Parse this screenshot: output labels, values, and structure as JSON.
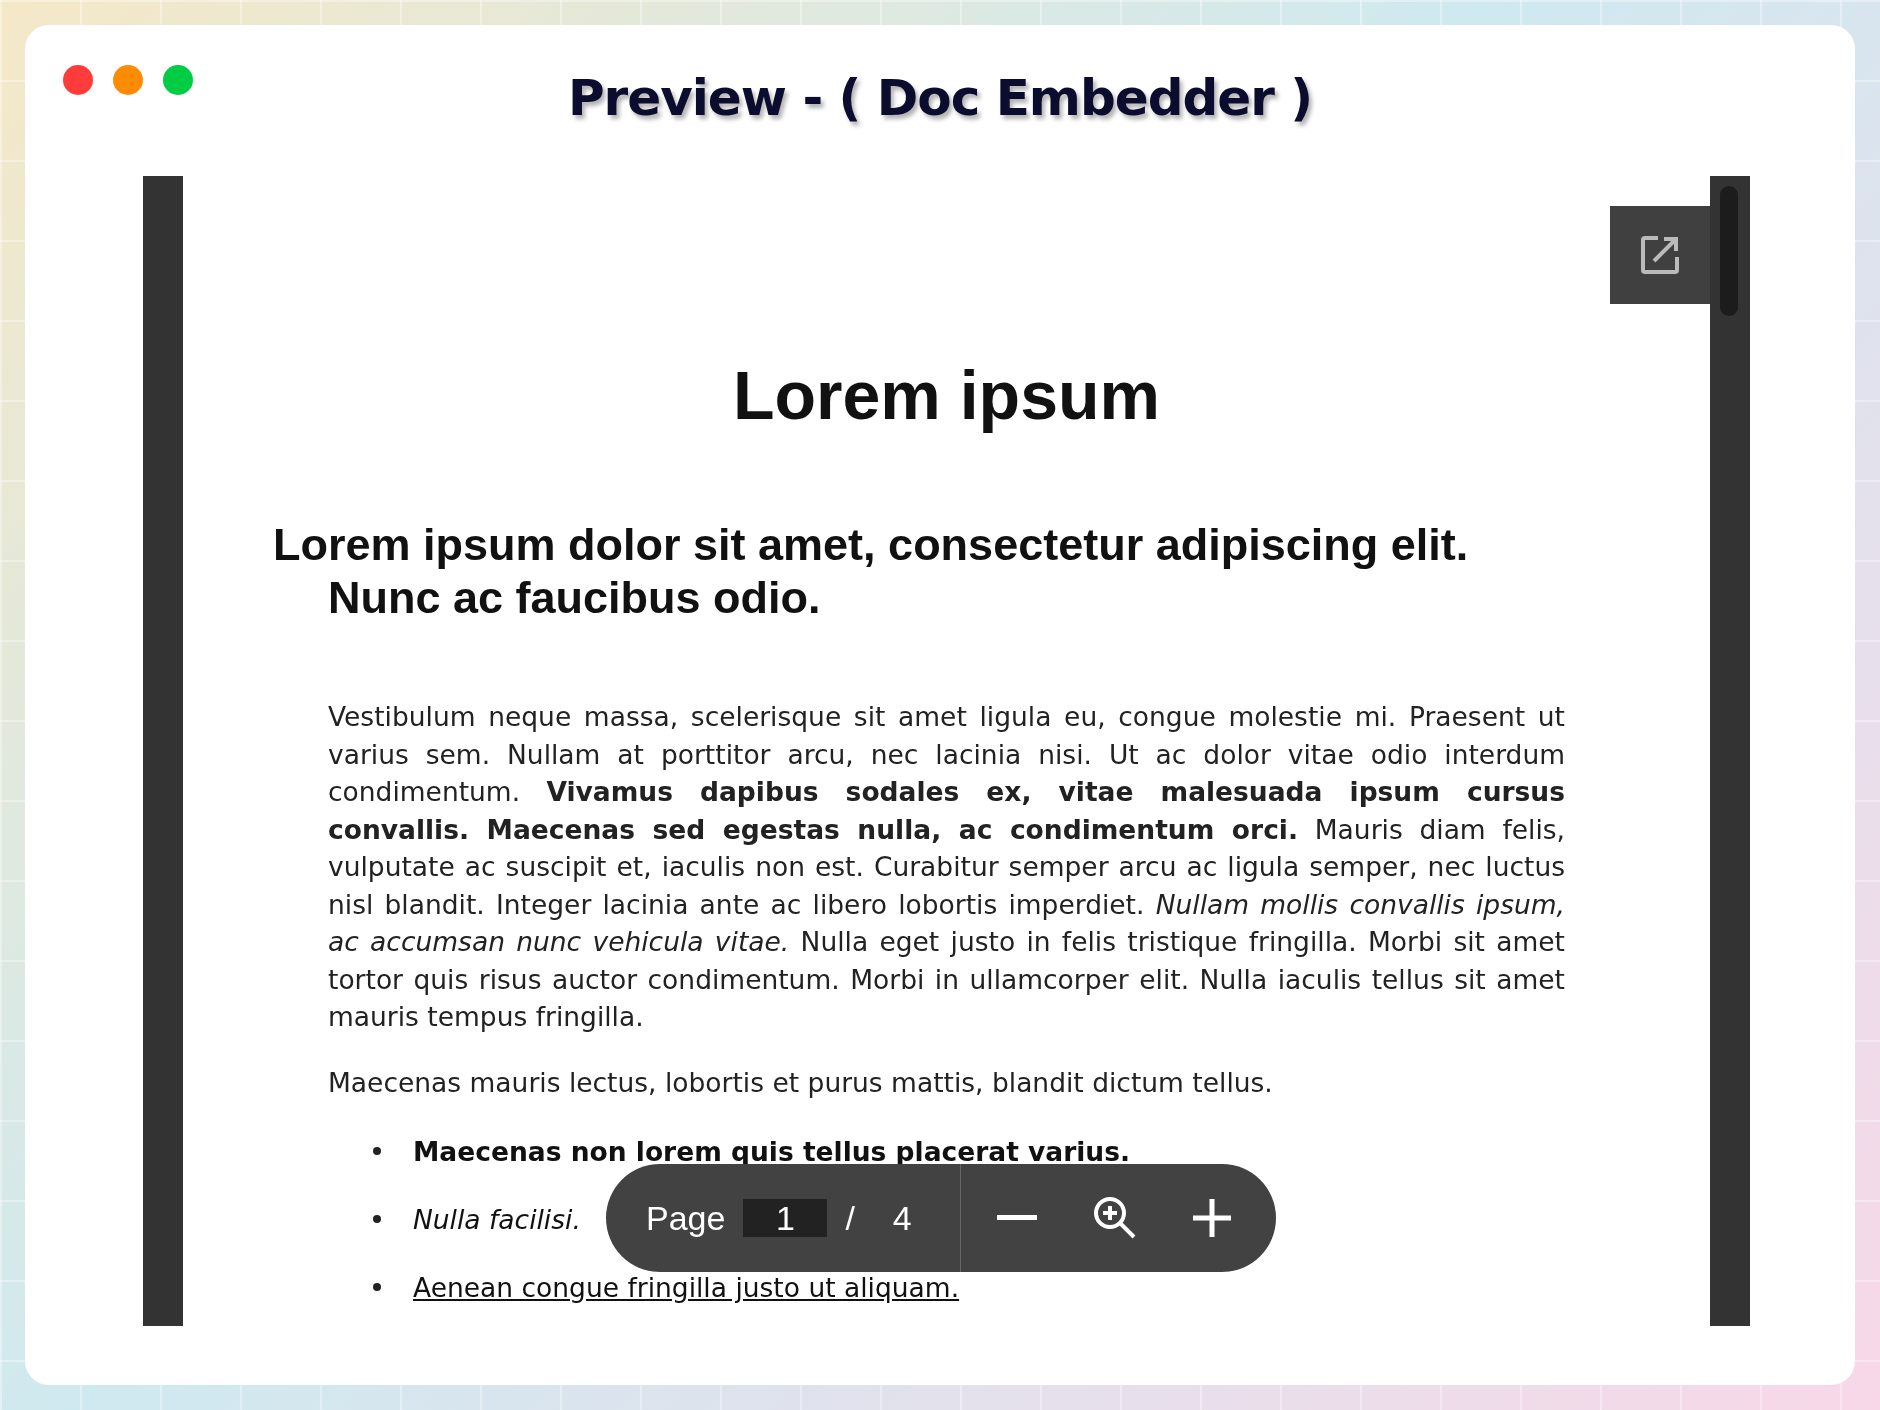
{
  "window": {
    "title": "Preview - ( Doc Embedder )",
    "controls": [
      {
        "color": "#ff3b3b"
      },
      {
        "color": "#ff8c00"
      },
      {
        "color": "#00cc44"
      }
    ]
  },
  "document": {
    "title": "Lorem ipsum",
    "heading": "Lorem ipsum dolor sit amet, consectetur adipiscing elit. Nunc ac faucibus odio.",
    "paragraphs": [
      "Vestibulum neque massa, scelerisque sit amet ligula eu, congue molestie mi. Praesent ut varius sem. Nullam at porttitor arcu, nec lacinia nisi. Ut ac dolor vitae odio interdum condimentum. **Vivamus dapibus sodales ex, vitae malesuada ipsum cursus convallis. Maecenas sed egestas nulla, ac condimentum orci.** Mauris diam felis, vulputate ac suscipit et, iaculis non est. Curabitur semper arcu ac ligula semper, nec luctus nisl blandit. Integer lacinia ante ac libero lobortis imperdiet. *Nullam mollis convallis ipsum, ac accumsan nunc vehicula vitae.* Nulla eget justo in felis tristique fringilla. Morbi sit amet tortor quis risus auctor condimentum. Morbi in ullamcorper elit. Nulla iaculis tellus sit amet mauris tempus fringilla.",
      "Maecenas mauris lectus, lobortis et purus mattis, blandit dictum tellus."
    ],
    "list": [
      {
        "kind": "bold",
        "text": "Maecenas non lorem quis tellus placerat varius."
      },
      {
        "kind": "italic",
        "text": "Nulla facilisi."
      },
      {
        "kind": "link",
        "text": "Aenean congue fringilla justo ut aliquam."
      }
    ]
  },
  "toolbar": {
    "page_label": "Page",
    "page": "1",
    "separator": "/",
    "total": "4"
  }
}
